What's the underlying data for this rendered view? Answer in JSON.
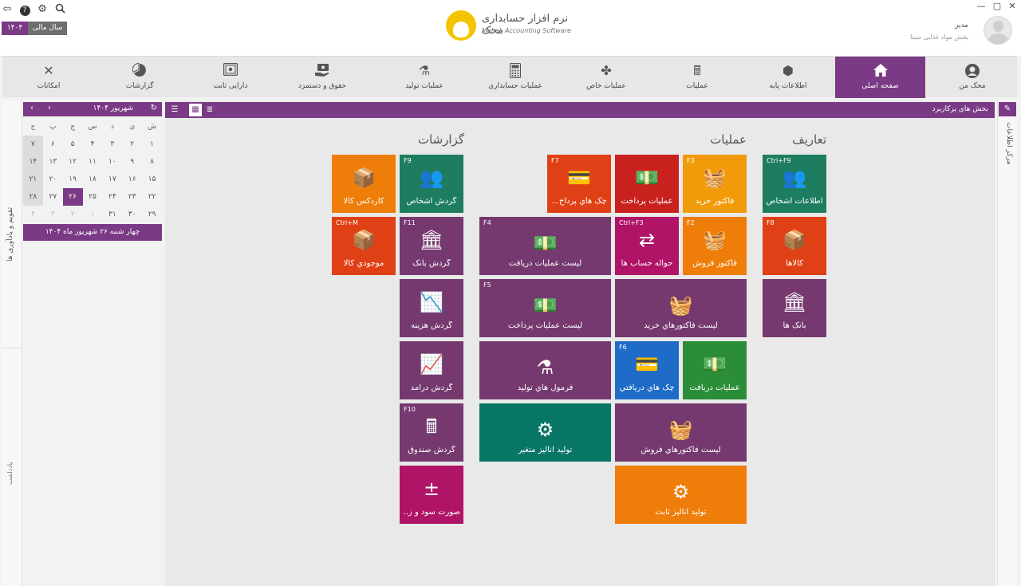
{
  "window": {
    "controls": [
      "✕",
      "▢",
      "—"
    ],
    "top_icons": [
      "search-icon",
      "gear-icon",
      "help-icon",
      "logout-icon"
    ]
  },
  "fiscal_year": {
    "label": "سال مالی",
    "value": "۱۴۰۴"
  },
  "logo": {
    "title_fa": "نرم افزار حسابداری محک",
    "title_en": "Mehak Accounting Software"
  },
  "user": {
    "role": "مدیر",
    "name": "پخش مواد غذایی سینا"
  },
  "ribbon": {
    "tabs": [
      {
        "id": "mehak-man",
        "label": "محک من",
        "icon": "user-circle-icon"
      },
      {
        "id": "home",
        "label": "صفحه اصلی",
        "icon": "home-icon",
        "active": true
      },
      {
        "id": "base-info",
        "label": "اطلاعات پایه",
        "icon": "cube-icon"
      },
      {
        "id": "operations",
        "label": "عملیات",
        "icon": "cash-register-icon"
      },
      {
        "id": "special-ops",
        "label": "عملیات خاص",
        "icon": "puzzle-icon"
      },
      {
        "id": "accounting-ops",
        "label": "عملیات حسابداری",
        "icon": "calculator-icon"
      },
      {
        "id": "production-ops",
        "label": "عملیات تولید",
        "icon": "factory-icon"
      },
      {
        "id": "payroll",
        "label": "حقوق و دستمزد",
        "icon": "money-hand-icon"
      },
      {
        "id": "fixed-assets",
        "label": "دارایی ثابت",
        "icon": "safe-icon"
      },
      {
        "id": "reports",
        "label": "گزارشات",
        "icon": "chart-pie-icon"
      },
      {
        "id": "facilities",
        "label": "امکانات",
        "icon": "tools-icon"
      }
    ]
  },
  "side": {
    "info_center": "مرکز اطلاعات",
    "calendar_label": "تقویم و یادآوری ها",
    "notes_label": "یادداشت"
  },
  "calendar": {
    "title": "شهریور ۱۴۰۴",
    "weekdays": [
      "ش",
      "ی",
      "د",
      "س",
      "چ",
      "پ",
      "ج"
    ],
    "weeks": [
      [
        "۱",
        "۲",
        "۳",
        "۴",
        "۵",
        "۶",
        "۷"
      ],
      [
        "۸",
        "۹",
        "۱۰",
        "۱۱",
        "۱۲",
        "۱۳",
        "۱۴"
      ],
      [
        "۱۵",
        "۱۶",
        "۱۷",
        "۱۸",
        "۱۹",
        "۲۰",
        "۲۱"
      ],
      [
        "۲۲",
        "۲۳",
        "۲۴",
        "۲۵",
        "۲۶",
        "۲۷",
        "۲۸"
      ],
      [
        "۲۹",
        "۳۰",
        "۳۱",
        "۱",
        "۲",
        "۳",
        "۴"
      ]
    ],
    "today": "۲۶",
    "footer": "چهار شنبه ۲۶ شهریور ماه ۱۴۰۴"
  },
  "main": {
    "title": "بخش های پرکاربرد",
    "groups": {
      "definitions": "تعاریف",
      "operations": "عملیات",
      "reports": "گزارشات"
    },
    "tiles": [
      {
        "id": "persons-info",
        "label": "اطلاعات اشخاص",
        "key": "Ctrl+F9",
        "icon": "people-icon",
        "color": "t-green"
      },
      {
        "id": "goods",
        "label": "کالاها",
        "key": "F8",
        "icon": "box-icon",
        "color": "t-red"
      },
      {
        "id": "banks",
        "label": "بانک ها",
        "key": "",
        "icon": "bank-icon",
        "color": "t-purple"
      },
      {
        "id": "purchase-invoice",
        "label": "فاکتور خرید",
        "key": "F3",
        "icon": "basket-icon",
        "color": "t-amber"
      },
      {
        "id": "payment-ops",
        "label": "عملیات پرداخت",
        "key": "",
        "icon": "money-out-icon",
        "color": "t-darkred"
      },
      {
        "id": "payable-cheques",
        "label": "چک هاي پرداخ...",
        "key": "F7",
        "icon": "cheque-out-icon",
        "color": "t-red"
      },
      {
        "id": "sales-invoice",
        "label": "فاکتور فروش",
        "key": "F2",
        "icon": "basket-icon",
        "color": "t-orange"
      },
      {
        "id": "account-transfer",
        "label": "حواله حساب ها",
        "key": "Ctrl+F3",
        "icon": "transfer-icon",
        "color": "t-magenta"
      },
      {
        "id": "receipt-list",
        "label": "لیست عملیات دریافت",
        "key": "F4",
        "icon": "money-in-icon",
        "color": "t-purple"
      },
      {
        "id": "purchase-invoices-list",
        "label": "لیست فاکتورهاي خرید",
        "key": "",
        "icon": "basket-icon",
        "color": "t-purple"
      },
      {
        "id": "payment-list",
        "label": "لیست عملیات پرداخت",
        "key": "F5",
        "icon": "money-out-icon",
        "color": "t-purple"
      },
      {
        "id": "receipt-ops",
        "label": "عملیات دریافت",
        "key": "",
        "icon": "money-in-icon",
        "color": "t-lgreen"
      },
      {
        "id": "receivable-cheques",
        "label": "چک هاي دریافتي",
        "key": "F6",
        "icon": "cheque-in-icon",
        "color": "t-blue"
      },
      {
        "id": "production-formulas",
        "label": "فرمول هاي تولید",
        "key": "",
        "icon": "flask-icon",
        "color": "t-purple"
      },
      {
        "id": "sales-invoices-list",
        "label": "لیست فاکتورهاي فروش",
        "key": "",
        "icon": "basket-icon",
        "color": "t-purple"
      },
      {
        "id": "variable-analysis",
        "label": "تولید آنالیز متغیر",
        "key": "",
        "icon": "gears-icon",
        "color": "t-teal"
      },
      {
        "id": "fixed-analysis",
        "label": "تولید آنالیز ثابت",
        "key": "",
        "icon": "gear-icon",
        "color": "t-orange"
      },
      {
        "id": "persons-turnover",
        "label": "گردش اشخاص",
        "key": "F9",
        "icon": "people-icon",
        "color": "t-green"
      },
      {
        "id": "goods-cardex",
        "label": "کاردکس کالا",
        "key": "",
        "icon": "box-icon",
        "color": "t-orange"
      },
      {
        "id": "bank-turnover",
        "label": "گردش بانک",
        "key": "F11",
        "icon": "bank-icon",
        "color": "t-purple"
      },
      {
        "id": "goods-stock",
        "label": "موجودي کالا",
        "key": "Ctrl+M",
        "icon": "box-icon",
        "color": "t-red"
      },
      {
        "id": "expense-turnover",
        "label": "گردش هزینه",
        "key": "",
        "icon": "chart-down-icon",
        "color": "t-purple"
      },
      {
        "id": "income-turnover",
        "label": "گردش درآمد",
        "key": "",
        "icon": "chart-up-icon",
        "color": "t-purple"
      },
      {
        "id": "cashbox-turnover",
        "label": "گردش صندوق",
        "key": "F10",
        "icon": "register-icon",
        "color": "t-purple"
      },
      {
        "id": "profit-loss",
        "label": "صورت سود و ز...",
        "key": "",
        "icon": "profit-icon",
        "color": "t-magenta"
      }
    ]
  }
}
